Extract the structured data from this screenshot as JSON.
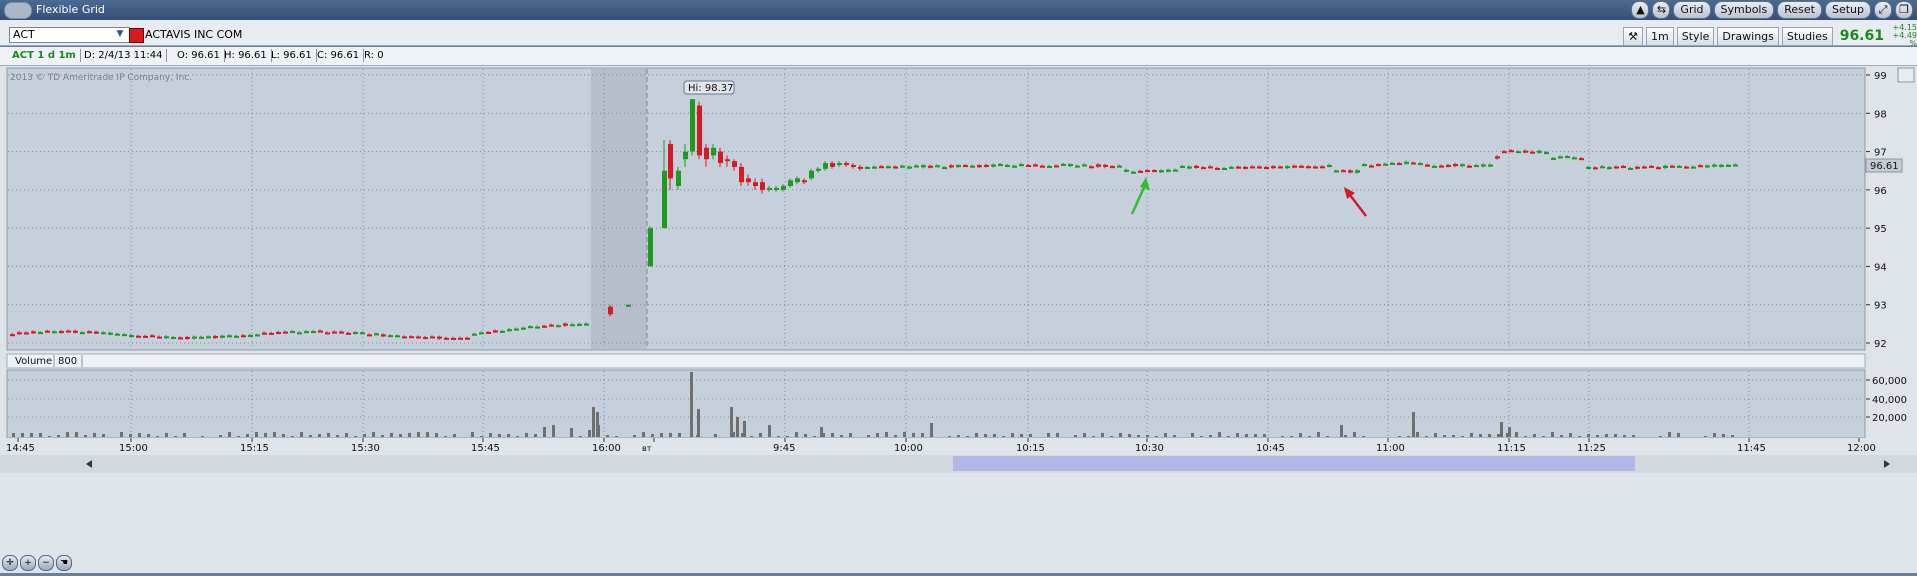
{
  "window": {
    "title": "Flexible Grid"
  },
  "titlebar_buttons": {
    "grid": "Grid",
    "symbols": "Symbols",
    "reset": "Reset",
    "setup": "Setup"
  },
  "symbol": {
    "value": "ACT",
    "company": "ACTAVIS INC COM",
    "color": "#d71a22"
  },
  "toolbar": {
    "interval": "1m",
    "style": "Style",
    "drawings": "Drawings",
    "studies": "Studies",
    "last": "96.61",
    "change": "+4.15",
    "change_pct": "+4.49 %"
  },
  "info": {
    "label": "ACT 1 d 1m",
    "date": "D: 2/4/13 11:44",
    "open": "O: 96.61",
    "high": "H: 96.61",
    "low": "L: 96.61",
    "close": "C: 96.61",
    "r": "R: 0"
  },
  "chart": {
    "copyright": "2013 © TD Ameritrade IP Company, Inc.",
    "hi_label": "Hi: 98.37",
    "price_tag": "96.61",
    "volume_label": "Volume",
    "volume_value": "800"
  },
  "chart_data": {
    "type": "candlestick",
    "price_axis": {
      "min": 92,
      "max": 99,
      "ticks": [
        99,
        98,
        97,
        96,
        95,
        94,
        93,
        92
      ]
    },
    "volume_axis": {
      "ticks": [
        "60,000",
        "40,000",
        "20,000"
      ]
    },
    "time_ticks": [
      "14:45",
      "15:00",
      "15:15",
      "15:30",
      "15:45",
      "16:00",
      "вт",
      "9:45",
      "10:00",
      "10:15",
      "10:30",
      "10:45",
      "11:00",
      "11:15",
      "11:25",
      "11:45",
      "12:00"
    ],
    "last_price": 96.61,
    "high": 98.37
  },
  "colors": {
    "up": "#1f9a1f",
    "down": "#d71a22",
    "chart_bg": "#c6d0dc",
    "extended_bg": "#b5bfcc"
  }
}
